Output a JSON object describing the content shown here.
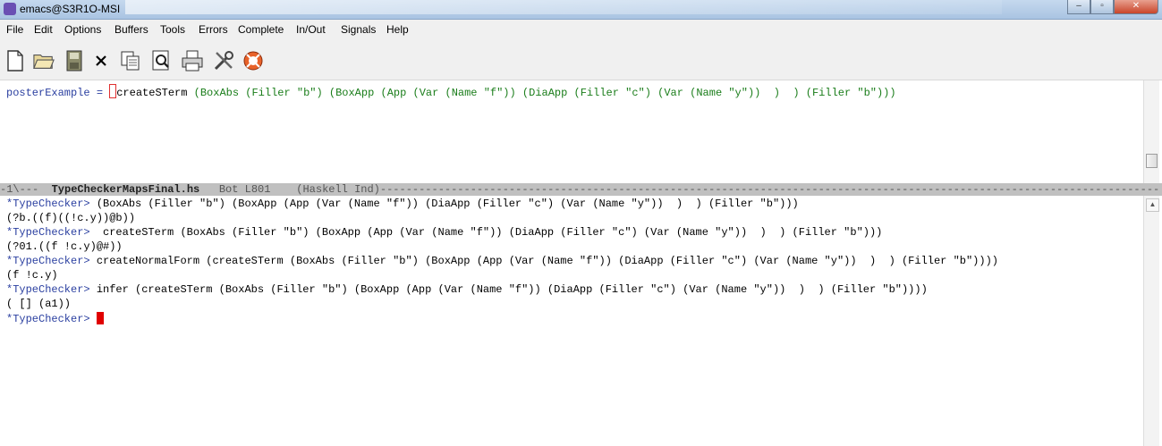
{
  "window": {
    "title": "emacs@S3R1O-MSI",
    "controls": {
      "minimize": "–",
      "maximize": "▫",
      "close": "✕"
    }
  },
  "menu": [
    "File",
    "Edit",
    "Options",
    "Buffers",
    "Tools",
    "Errors",
    "Complete",
    "In/Out",
    "Signals",
    "Help"
  ],
  "toolbar": {
    "icons": [
      "new-file-icon",
      "open-folder-icon",
      "save-icon",
      "close-buffer-icon",
      "copy-icon",
      "search-icon",
      "print-icon",
      "preferences-icon",
      "help-icon"
    ]
  },
  "editor": {
    "lhs": "posterExample",
    "eq": " = ",
    "call": "createSTerm",
    "args": " (BoxAbs (Filler \"b\") (BoxApp (App (Var (Name \"f\")) (DiaApp (Filler \"c\") (Var (Name \"y\"))  )  ) (Filler \"b\")))"
  },
  "modeline": {
    "prefix": "-1\\---  ",
    "buffer": "TypeCheckerMapsFinal.hs",
    "pos": "   Bot L801    (Haskell Ind)",
    "fill": "-------------------------------------------------------------------------------------------------------------------------"
  },
  "repl": {
    "prompt": "*TypeChecker>",
    "lines": [
      {
        "type": "input",
        "text": " (BoxAbs (Filler \"b\") (BoxApp (App (Var (Name \"f\")) (DiaApp (Filler \"c\") (Var (Name \"y\"))  )  ) (Filler \"b\")))"
      },
      {
        "type": "output",
        "text": "(?b.((f)((!c.y))@b))"
      },
      {
        "type": "input",
        "text": "  createSTerm (BoxAbs (Filler \"b\") (BoxApp (App (Var (Name \"f\")) (DiaApp (Filler \"c\") (Var (Name \"y\"))  )  ) (Filler \"b\")))"
      },
      {
        "type": "output",
        "text": "(?01.((f !c.y)@#))"
      },
      {
        "type": "input",
        "text": " createNormalForm (createSTerm (BoxAbs (Filler \"b\") (BoxApp (App (Var (Name \"f\")) (DiaApp (Filler \"c\") (Var (Name \"y\"))  )  ) (Filler \"b\"))))"
      },
      {
        "type": "output",
        "text": "(f !c.y)"
      },
      {
        "type": "input",
        "text": " infer (createSTerm (BoxAbs (Filler \"b\") (BoxApp (App (Var (Name \"f\")) (DiaApp (Filler \"c\") (Var (Name \"y\"))  )  ) (Filler \"b\"))))"
      },
      {
        "type": "output",
        "text": "( [] (a1))"
      },
      {
        "type": "input",
        "text": " "
      }
    ]
  }
}
